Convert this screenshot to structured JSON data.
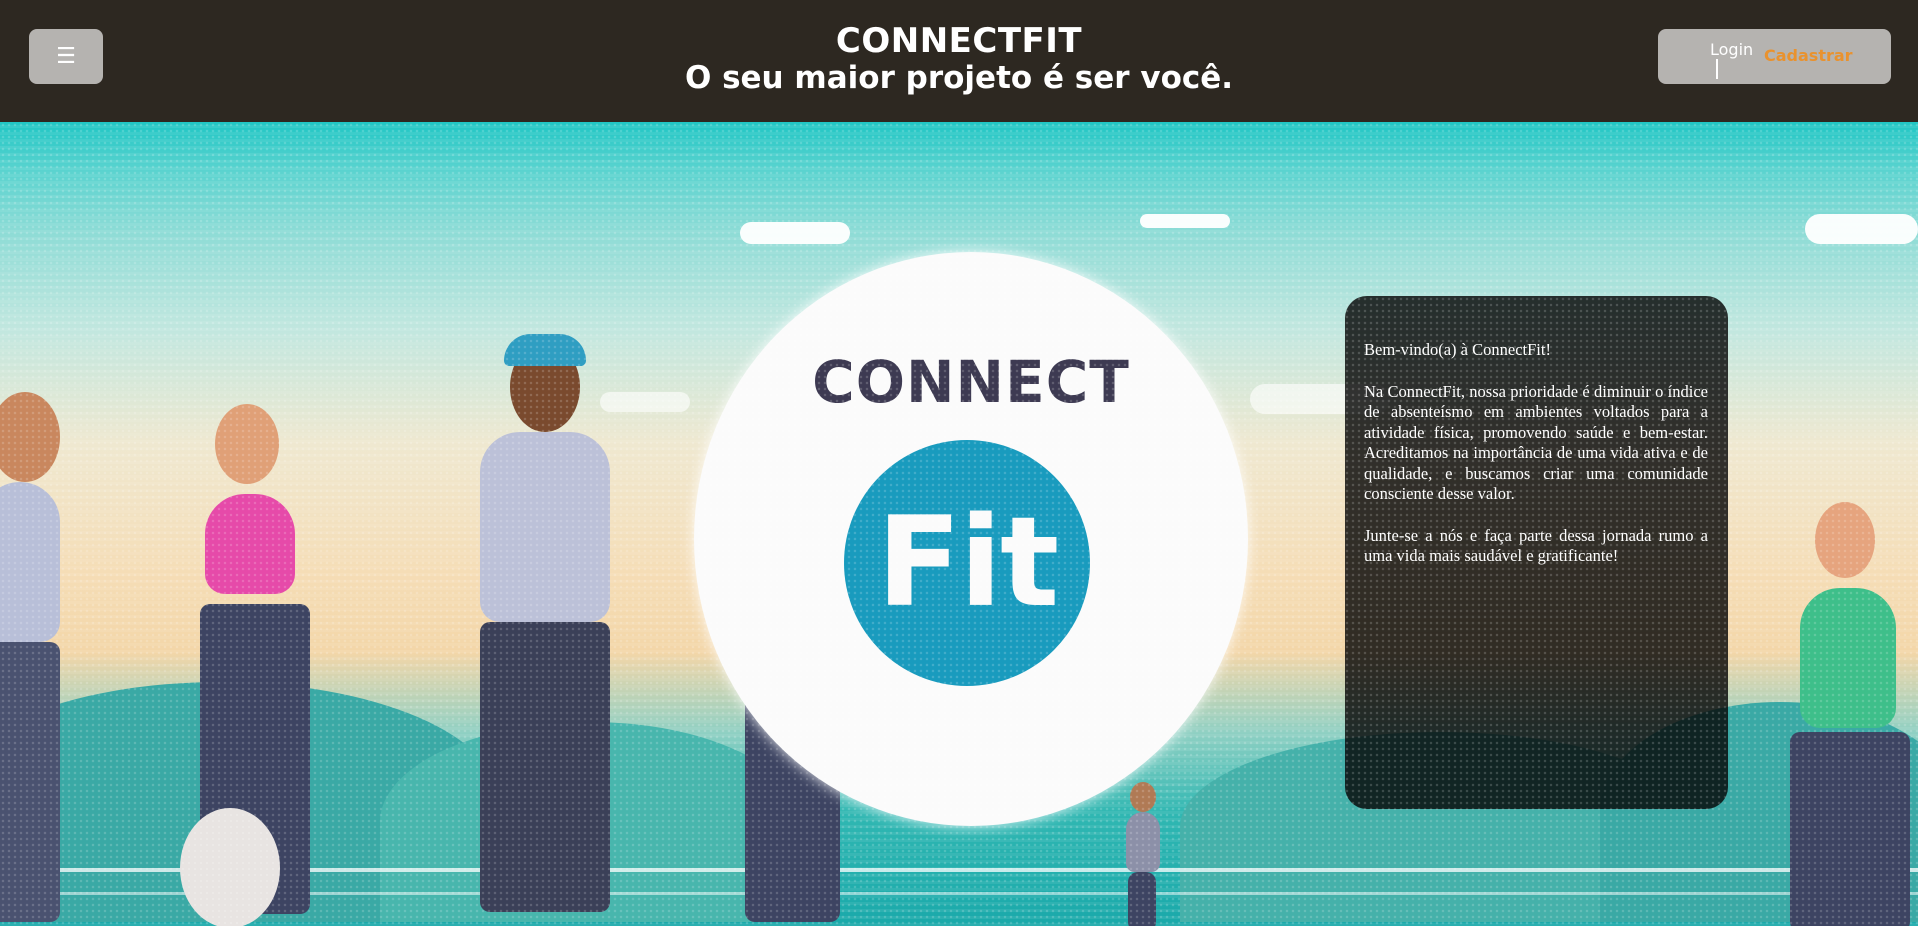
{
  "header": {
    "menu_icon": "☰",
    "title": "CONNECTFIT",
    "tagline": "O seu maior projeto é ser você.",
    "login_label": "Login",
    "signup_label": "Cadastrar"
  },
  "hero": {
    "logo_top": "CONNECT",
    "logo_bottom": "Fit"
  },
  "welcome": {
    "greeting": "Bem-vindo(a) à ConnectFit!",
    "paragraph_1": "Na ConnectFit, nossa prioridade é diminuir o índice de absenteísmo em ambientes voltados para a atividade física, promovendo saúde e bem-estar. Acreditamos na importância de uma vida ativa e de qualidade, e buscamos criar uma comunidade consciente desse valor.",
    "paragraph_2": "Junte-se a nós e faça parte dessa jornada rumo a uma vida mais saudável e gratificante!"
  },
  "colors": {
    "header_bg": "#2d2821",
    "button_bg": "#b5b3b0",
    "signup_accent": "#e9922e",
    "logo_blue": "#199bbe",
    "logo_dark": "#3d3a52"
  }
}
